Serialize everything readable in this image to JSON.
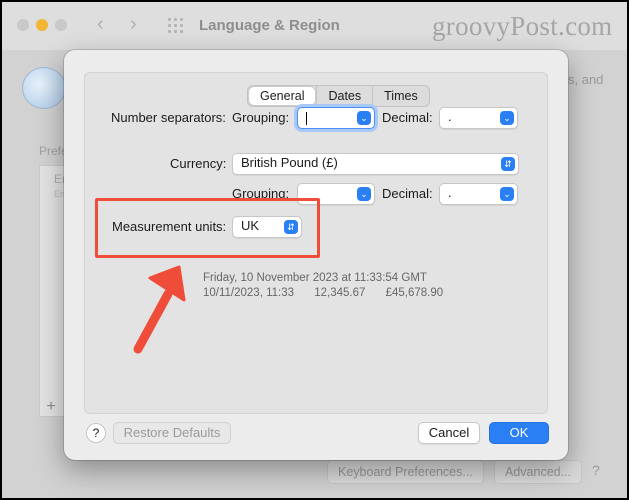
{
  "background_window": {
    "title": "Language & Region",
    "watermark": "groovyPost.com",
    "description_fragment": "s, and",
    "preferred_label": "Prefe",
    "list_item": "En",
    "list_item_sub": "En",
    "add_button": "+",
    "keyboard_button": "Keyboard Preferences...",
    "advanced_button": "Advanced...",
    "help_button": "?"
  },
  "sheet": {
    "tabs": [
      {
        "label": "General",
        "selected": true
      },
      {
        "label": "Dates",
        "selected": false
      },
      {
        "label": "Times",
        "selected": false
      }
    ],
    "number_separators": {
      "label": "Number separators:",
      "grouping_label": "Grouping:",
      "grouping_value": "",
      "decimal_label": "Decimal:",
      "decimal_value": "."
    },
    "currency": {
      "label": "Currency:",
      "value": "British Pound (£)",
      "grouping_label": "Grouping:",
      "grouping_value": "",
      "decimal_label": "Decimal:",
      "decimal_value": "."
    },
    "measurement": {
      "label": "Measurement units:",
      "value": "UK"
    },
    "preview": {
      "datetime": "Friday, 10 November 2023 at 11:33:54 GMT",
      "short_date": "10/11/2023, 11:33",
      "number": "12,345.67",
      "currency": "£45,678.90"
    },
    "buttons": {
      "help": "?",
      "restore": "Restore Defaults",
      "cancel": "Cancel",
      "ok": "OK"
    }
  },
  "colors": {
    "accent": "#2a7ff5",
    "annotation": "#ef4d3a"
  }
}
